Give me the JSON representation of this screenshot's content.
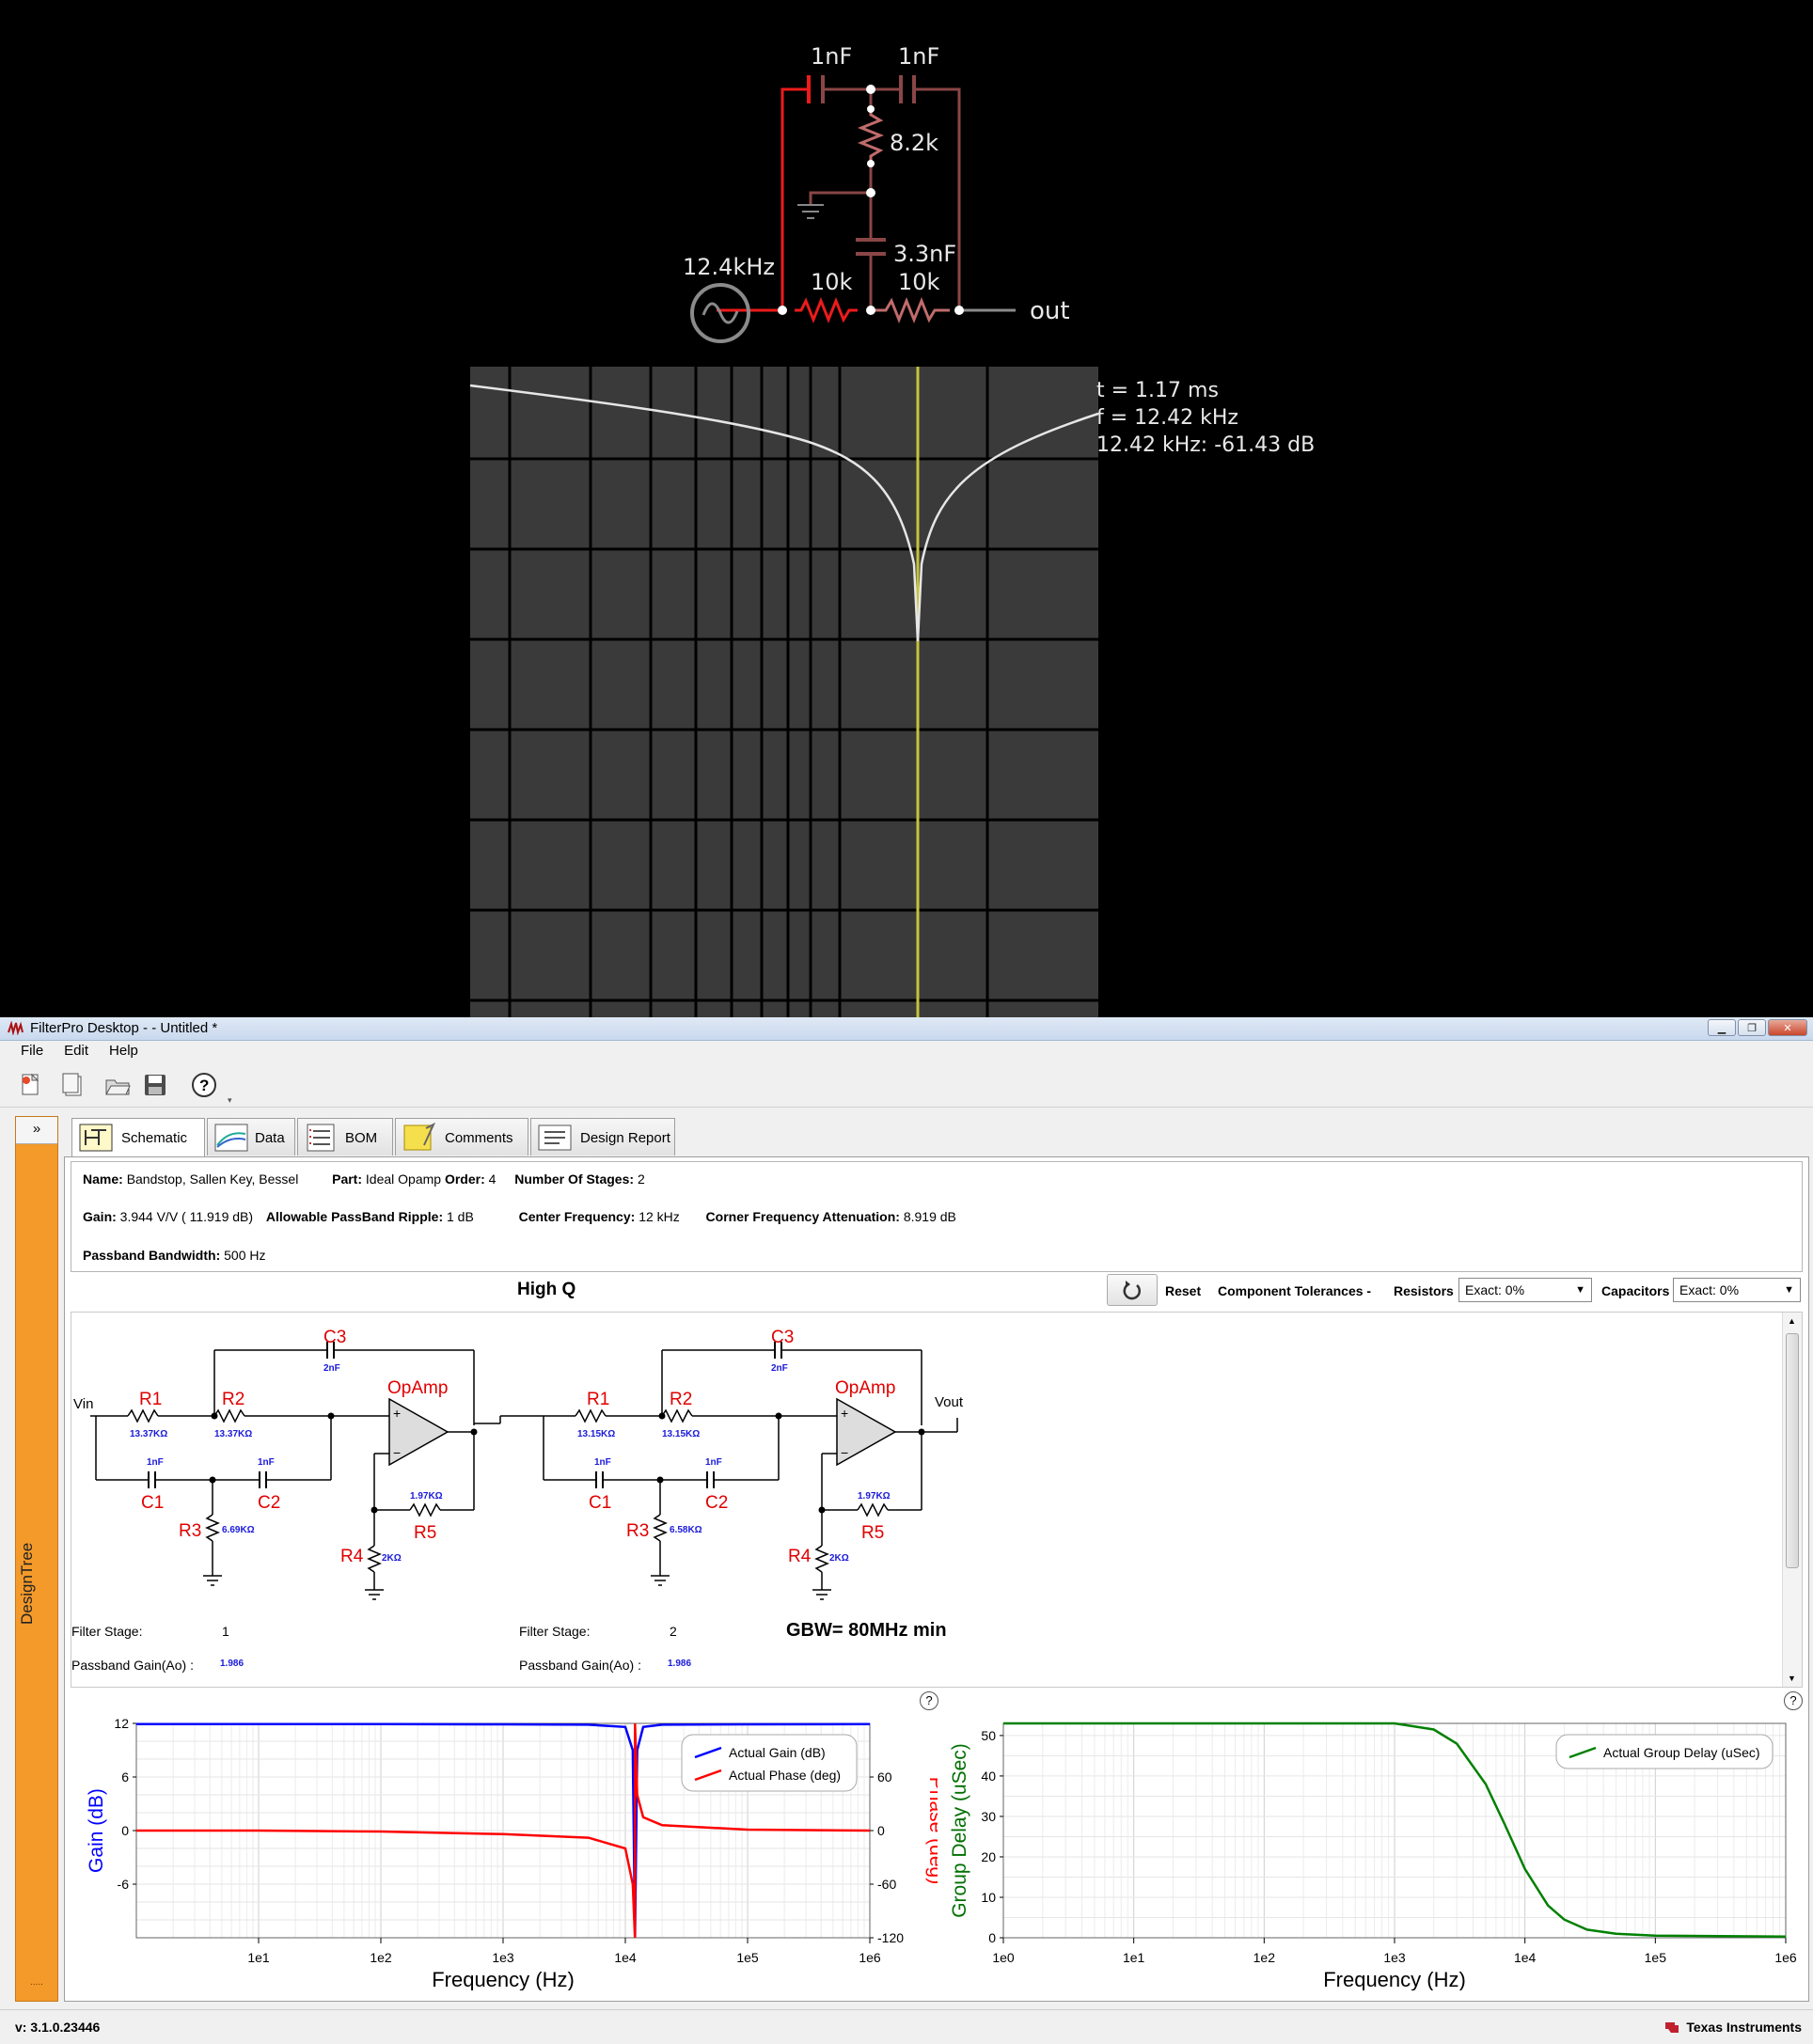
{
  "sim": {
    "cap1": "1nF",
    "cap2": "1nF",
    "res_top": "8.2k",
    "cap3": "3.3nF",
    "res_left": "10k",
    "res_right": "10k",
    "source_freq": "12.4kHz",
    "out_label": "out",
    "scope_t": "t = 1.17 ms",
    "scope_f": "f = 12.42 kHz",
    "scope_db": "12.42 kHz: -61.43 dB"
  },
  "window": {
    "title": "FilterPro Desktop -  - Untitled *"
  },
  "menu": [
    "File",
    "Edit",
    "Help"
  ],
  "sidebar": {
    "header": "»",
    "label": "DesignTree",
    "grip": "....."
  },
  "tabs": [
    "Schematic",
    "Data",
    "BOM",
    "Comments",
    "Design Report"
  ],
  "info": {
    "name_label": "Name:",
    "name_value": "Bandstop, Sallen Key, Bessel",
    "part_label": "Part:",
    "part_value": "Ideal Opamp",
    "order_label": "Order:",
    "order_value": "4",
    "stages_label": "Number Of Stages:",
    "stages_value": "2",
    "gain_label": "Gain:",
    "gain_value": "3.944 V/V ( 11.919 dB)",
    "ripple_label": "Allowable PassBand Ripple:",
    "ripple_value": "1 dB",
    "center_label": "Center Frequency:",
    "center_value": "12 kHz",
    "atten_label": "Corner Frequency Attenuation:",
    "atten_value": "8.919 dB",
    "bw_label": "Passband Bandwidth:",
    "bw_value": "500 Hz"
  },
  "controls": {
    "section_title": "High Q",
    "reset": "Reset",
    "tolerances": "Component Tolerances -",
    "resistors_label": "Resistors",
    "resistors_value": "Exact: 0%",
    "capacitors_label": "Capacitors",
    "capacitors_value": "Exact: 0%"
  },
  "schematic": {
    "vin": "Vin",
    "vout": "Vout",
    "opamp": "OpAmp",
    "gbw": "GBW= 80MHz min",
    "filter_stage_label": "Filter Stage:",
    "passband_gain_label": "Passband Gain(Ao) :",
    "stages": [
      {
        "number": "1",
        "gain": "1.986",
        "r1": "13.37KΩ",
        "r2": "13.37KΩ",
        "c1": "1nF",
        "c2": "1nF",
        "c3": "2nF",
        "r3": "6.69KΩ",
        "r4": "2KΩ",
        "r5": "1.97KΩ"
      },
      {
        "number": "2",
        "gain": "1.986",
        "r1": "13.15KΩ",
        "r2": "13.15KΩ",
        "c1": "1nF",
        "c2": "1nF",
        "c3": "2nF",
        "r3": "6.58KΩ",
        "r4": "2KΩ",
        "r5": "1.97KΩ"
      }
    ],
    "names": {
      "r1": "R1",
      "r2": "R2",
      "r3": "R3",
      "r4": "R4",
      "r5": "R5",
      "c1": "C1",
      "c2": "C2",
      "c3": "C3"
    }
  },
  "chart_data": [
    {
      "type": "line",
      "xlabel": "Frequency (Hz)",
      "ylabel": "Gain (dB)",
      "y2label": "Phase (deg)",
      "xscale": "log",
      "xlim": [
        1,
        1000000
      ],
      "ylim": [
        -12,
        12
      ],
      "y2lim": [
        -120,
        120
      ],
      "xticks": [
        "1e1",
        "1e2",
        "1e3",
        "1e4",
        "1e5",
        "1e6"
      ],
      "yticks": [
        "12",
        "6",
        "0",
        "-6"
      ],
      "y2ticks": [
        "60",
        "0",
        "-60",
        "-120"
      ],
      "legend": "top-right",
      "grid": true,
      "series": [
        {
          "name": "Actual Gain (dB)",
          "color": "#0000ff",
          "axis": "left",
          "x": [
            1,
            10,
            100,
            1000,
            5000,
            10000,
            11500,
            12000,
            12500,
            14000,
            20000,
            100000,
            1000000
          ],
          "y": [
            11.92,
            11.92,
            11.92,
            11.9,
            11.85,
            11.6,
            9,
            -45,
            9,
            11.6,
            11.85,
            11.9,
            11.92
          ]
        },
        {
          "name": "Actual Phase (deg)",
          "color": "#ff0000",
          "axis": "right",
          "x": [
            1,
            10,
            100,
            1000,
            5000,
            10000,
            11500,
            11990,
            12010,
            12500,
            14000,
            20000,
            100000,
            1000000
          ],
          "y": [
            0,
            0,
            -1,
            -4,
            -8,
            -20,
            -60,
            -180,
            180,
            40,
            15,
            6,
            1,
            0
          ]
        }
      ]
    },
    {
      "type": "line",
      "xlabel": "Frequency (Hz)",
      "ylabel": "Group Delay (uSec)",
      "xscale": "log",
      "xlim": [
        1,
        1000000
      ],
      "ylim": [
        0,
        53
      ],
      "xticks": [
        "1e0",
        "1e1",
        "1e2",
        "1e3",
        "1e4",
        "1e5",
        "1e6"
      ],
      "yticks": [
        "50",
        "40",
        "30",
        "20",
        "10",
        "0"
      ],
      "legend": "top-right",
      "grid": true,
      "series": [
        {
          "name": "Actual Group Delay (uSec)",
          "color": "#008000",
          "x": [
            1,
            10,
            100,
            1000,
            2000,
            3000,
            5000,
            7000,
            10000,
            15000,
            20000,
            30000,
            50000,
            100000,
            1000000
          ],
          "y": [
            53.4,
            53.4,
            53.4,
            53,
            51.5,
            48,
            38,
            28,
            17,
            8,
            4.5,
            2,
            1,
            0.5,
            0.3
          ]
        }
      ]
    }
  ],
  "status": {
    "version": "v: 3.1.0.23446",
    "vendor": "Texas Instruments"
  }
}
